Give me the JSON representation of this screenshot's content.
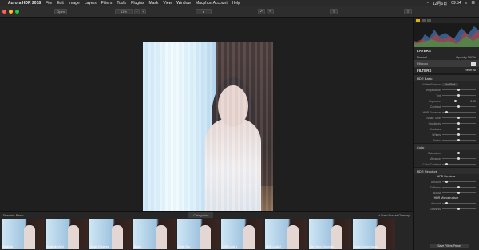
{
  "menubar": {
    "app": "Aurora HDR 2018",
    "items": [
      "File",
      "Edit",
      "Image",
      "Layers",
      "Filters",
      "Tools",
      "Plugins",
      "Mask",
      "View",
      "Window",
      "Macphun Account",
      "Help"
    ],
    "clock": "09:54",
    "date": "12月6日"
  },
  "toolbar": {
    "open_label": "Open",
    "zoom_label": "61%"
  },
  "filmstrip": {
    "presets_label": "Presets: Basic",
    "categories_label": "Categories",
    "new_preset_label": "+ New Preset Overlay",
    "thumbs": [
      "Realistic",
      "Realistic Vivid",
      "Smart Enhance",
      "Bright",
      "Deep Sky",
      "HDR Look 1",
      "HDR Look 2",
      "For Deep Shadows",
      "Tonal Compression",
      "Structure Bold"
    ]
  },
  "panel": {
    "layers_title": "LAYERS",
    "normal_label": "Normal",
    "opacity_label": "Opacity 100%",
    "layer_name": "Filtrpolo",
    "filters_title": "FILTERS",
    "reset_all": "Reset All",
    "hdr_basic": "HDR Basic",
    "basic_rows": [
      "White Balance",
      "Temperature",
      "Tint",
      "Exposure",
      "Contrast",
      "HDR Enhance",
      "Smart Tone",
      "Highlights",
      "Shadows",
      "Whites",
      "Blacks"
    ],
    "wb_value": "As Shot",
    "exposure_value": "0.00",
    "color_title": "Color",
    "color_rows": [
      "Saturation",
      "Vibrance",
      "Color Contrast"
    ],
    "structure_title": "HDR Structure",
    "structure_sub": "HDR Structure",
    "structure_rows": [
      "Amount",
      "Softness",
      "Boost"
    ],
    "micro_sub": "HDR Microstructure",
    "micro_rows": [
      "Amount",
      "Softness"
    ],
    "save_filters": "Save Filters Preset"
  }
}
